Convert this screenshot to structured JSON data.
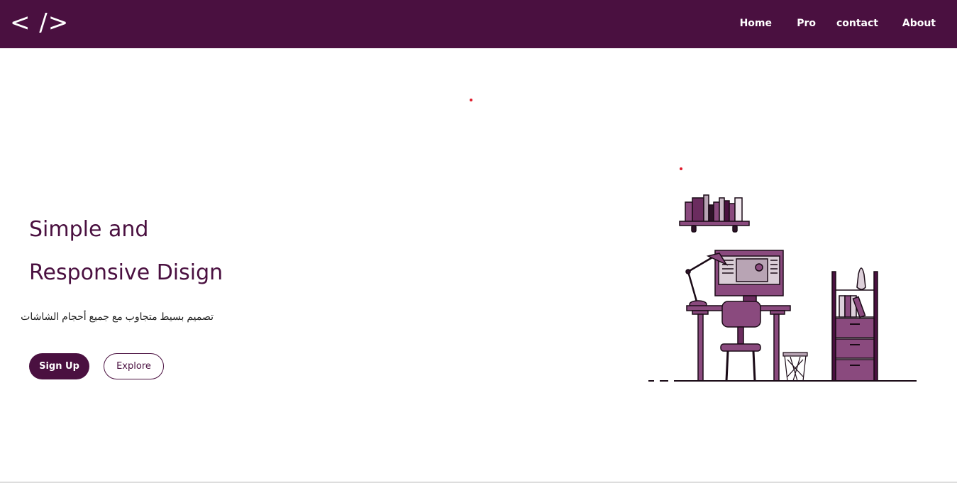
{
  "header": {
    "logo_text": "< />",
    "nav": [
      {
        "label": "Home"
      },
      {
        "label": "Pro"
      },
      {
        "label": "contact"
      },
      {
        "label": "About"
      }
    ]
  },
  "hero": {
    "headline_line1": "Simple and",
    "headline_line2": "Responsive Disign",
    "subtitle": "تصميم بسيط متجاوب مع جميع أحجام الشاشات",
    "signup_label": "Sign Up",
    "explore_label": "Explore"
  },
  "colors": {
    "brand": "#4a1040",
    "accent_dot": "#e01c2c",
    "illustration_fill": "#8a4a7e",
    "background": "#ffffff"
  },
  "illustration": {
    "name": "workspace-desk-illustration"
  }
}
